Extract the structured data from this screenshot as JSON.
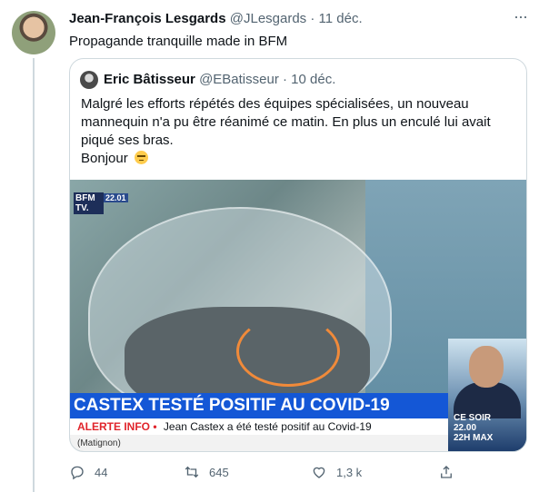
{
  "tweet": {
    "author_name": "Jean-François Lesgards",
    "handle": "@JLesgards",
    "separator": "·",
    "date": "11 déc.",
    "text": "Propagande tranquille made in BFM",
    "more": "···",
    "quoted": {
      "author_name": "Eric Bâtisseur",
      "handle": "@EBatisseur",
      "separator": "·",
      "date": "10 déc.",
      "text_lines": [
        "Malgré les efforts répétés des équipes spécialisées, un nouveau",
        "mannequin n'a pu être réanimé ce matin. En plus un enculé lui avait",
        "piqué ses bras."
      ],
      "greeting": "Bonjour",
      "emoji": "unamused-face",
      "media": {
        "logo_line1": "BFM",
        "logo_line2": "TV.",
        "clock": "22.01",
        "headline": "CASTEX TESTÉ POSITIF AU COVID-19",
        "alert_label": "ALERTE INFO",
        "alert_bullet": "•",
        "alert_text": "Jean Castex a été testé positif au Covid-19",
        "location": "(Matignon)",
        "show_line1": "CE SOIR",
        "show_line2": "22.00",
        "show_line3": "22H MAX"
      }
    },
    "actions": {
      "reply_count": "44",
      "retweet_count": "645",
      "like_count": "1,3 k"
    }
  },
  "colors": {
    "banner_blue": "#1457d6",
    "alert_red": "#e0242b",
    "highlight_orange": "#f08a3a",
    "icon_gray": "#536471"
  }
}
